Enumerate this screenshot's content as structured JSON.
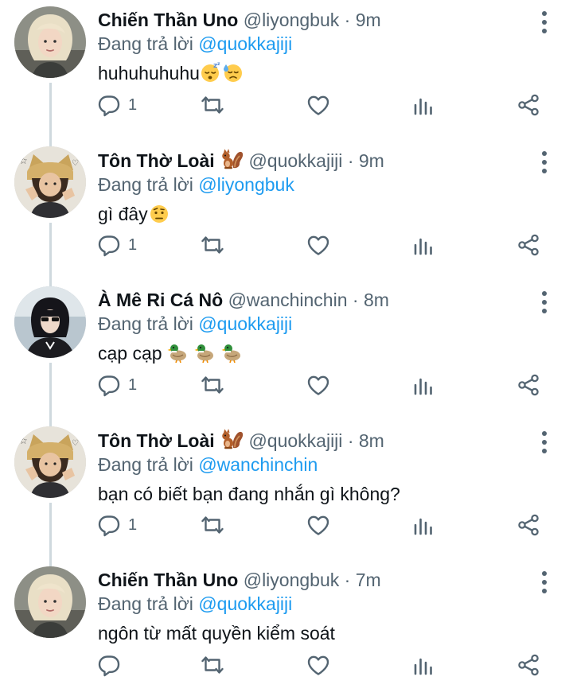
{
  "tweets": [
    {
      "author": "Chiến Thần Uno",
      "handle": "@liyongbuk",
      "dot": "·",
      "time": "9m",
      "reply_prefix": "Đang trả lời ",
      "reply_to": "@quokkajiji",
      "text": "huhuhuhuhu",
      "text_emojis": [
        "sleeping-face",
        "sad-sweat-face"
      ],
      "reply_count": "1",
      "avatar": "blonde-person-avatar"
    },
    {
      "author": "Tôn Thờ Loài",
      "author_emoji": "squirrel",
      "handle": "@quokkajiji",
      "dot": "·",
      "time": "9m",
      "reply_prefix": "Đang trả lời ",
      "reply_to": "@liyongbuk",
      "text": "gì đây",
      "text_emojis": [
        "raised-eyebrow-face"
      ],
      "reply_count": "1",
      "avatar": "cat-hat-person-avatar"
    },
    {
      "author": "À Mê Ri Cá Nô",
      "handle": "@wanchinchin",
      "dot": "·",
      "time": "8m",
      "reply_prefix": "Đang trả lời ",
      "reply_to": "@quokkajiji",
      "text": "cạp cạp ",
      "text_emojis": [
        "duck",
        "duck",
        "duck"
      ],
      "reply_count": "1",
      "avatar": "dark-hair-person-avatar"
    },
    {
      "author": "Tôn Thờ Loài",
      "author_emoji": "squirrel",
      "handle": "@quokkajiji",
      "dot": "·",
      "time": "8m",
      "reply_prefix": "Đang trả lời ",
      "reply_to": "@wanchinchin",
      "text": "bạn có biết bạn đang nhắn gì không?",
      "text_emojis": [],
      "reply_count": "1",
      "avatar": "cat-hat-person-avatar"
    },
    {
      "author": "Chiến Thần Uno",
      "handle": "@liyongbuk",
      "dot": "·",
      "time": "7m",
      "reply_prefix": "Đang trả lời ",
      "reply_to": "@quokkajiji",
      "text": "ngôn từ mất quyền kiểm soát",
      "text_emojis": [],
      "reply_count": "",
      "avatar": "blonde-person-avatar"
    }
  ],
  "icons": {
    "reply": "reply-icon",
    "retweet": "retweet-icon",
    "like": "like-icon",
    "views": "views-icon",
    "share": "share-icon",
    "more": "more-icon"
  },
  "colors": {
    "text": "#0f1419",
    "secondary": "#536471",
    "mention": "#1d9bf0",
    "thread_line": "#cfd9de"
  }
}
